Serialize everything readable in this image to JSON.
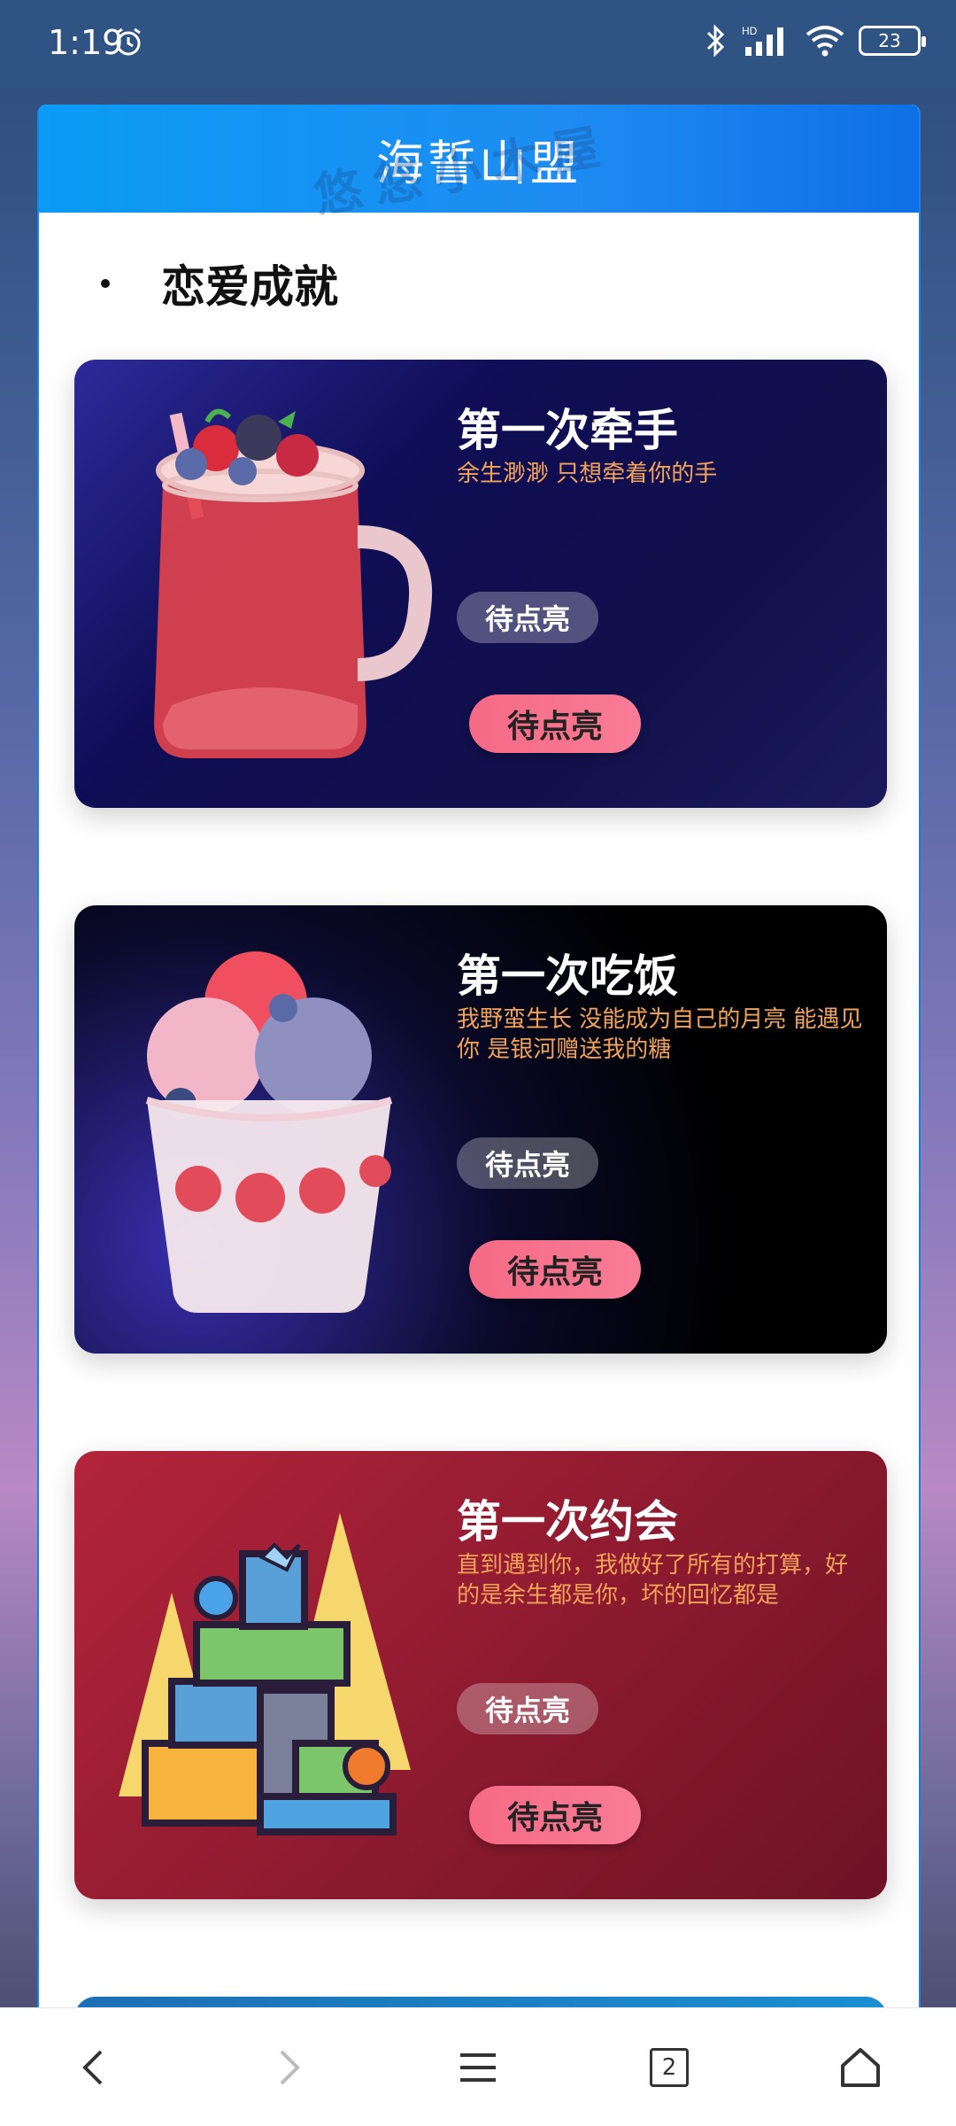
{
  "status_bar": {
    "time": "1:19",
    "battery": "23",
    "network_label": "HD"
  },
  "header": {
    "title": "海誓山盟",
    "watermark": "悠悠小木屋"
  },
  "section": {
    "title": "恋爱成就"
  },
  "achievements": [
    {
      "name": "第一次牵手",
      "desc": "余生渺渺 只想牵着你的手",
      "status": "待点亮",
      "button": "待点亮",
      "icon": "berry-drink-icon"
    },
    {
      "name": "第一次吃饭",
      "desc": "我野蛮生长 没能成为自己的月亮 能遇见你 是银河赠送我的糖",
      "status": "待点亮",
      "button": "待点亮",
      "icon": "ice-cream-cup-icon"
    },
    {
      "name": "第一次约会",
      "desc": "直到遇到你，我做好了所有的打算，好的是余生都是你，坏的回忆都是",
      "status": "待点亮",
      "button": "待点亮",
      "icon": "gift-boxes-icon"
    }
  ],
  "navbar": {
    "tab_count": "2"
  },
  "colors": {
    "header_blue": "#1e8cf2",
    "desc_orange": "#f2a35a",
    "button_pink": "#f56a85"
  }
}
